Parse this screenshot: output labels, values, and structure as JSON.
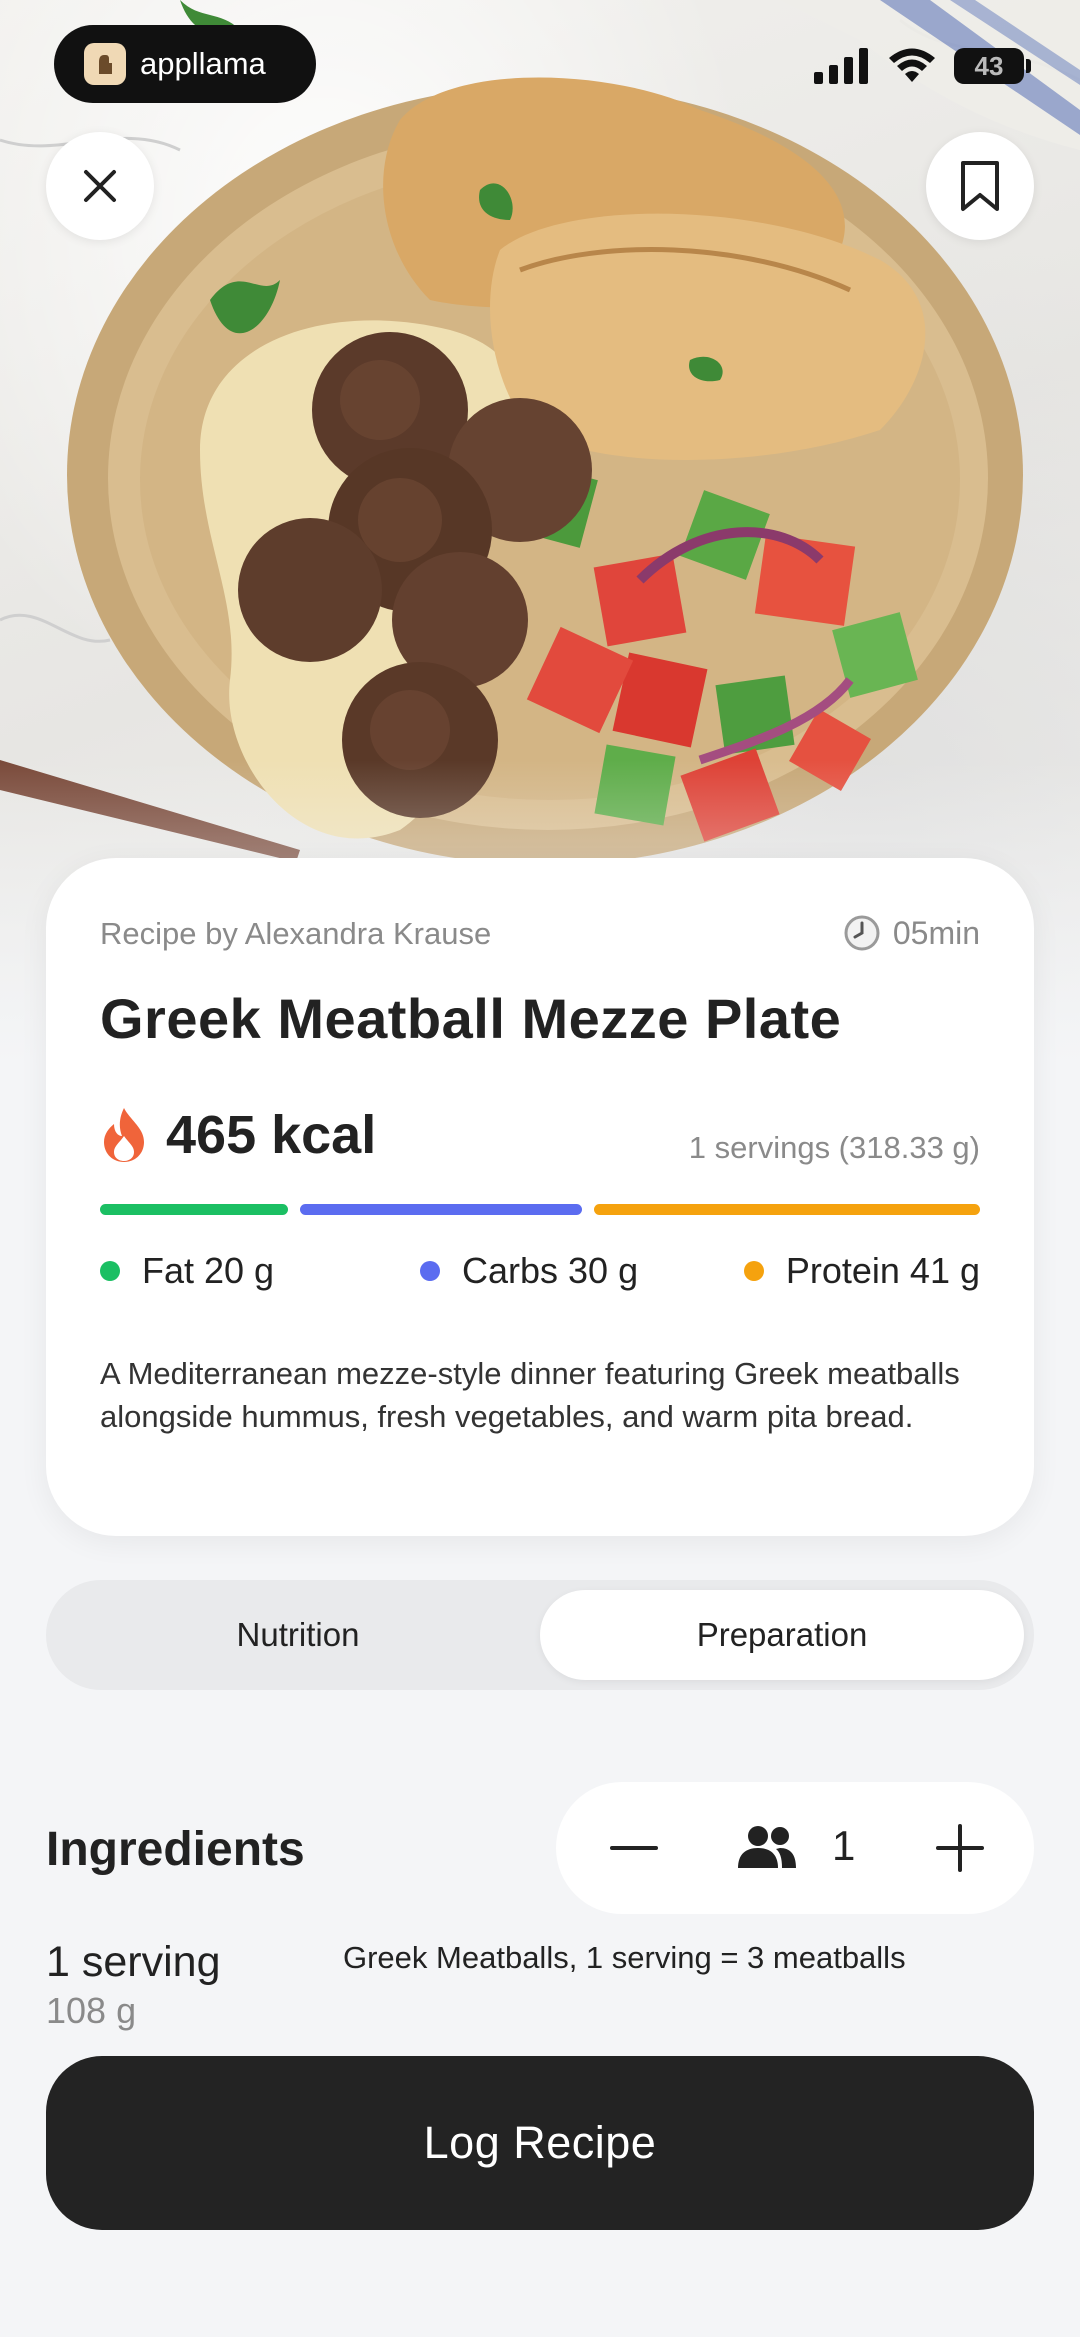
{
  "status_bar": {
    "pill_label": "appllama",
    "battery": "43"
  },
  "recipe": {
    "author": "Recipe by Alexandra Krause",
    "time": "05min",
    "title": "Greek Meatball Mezze Plate",
    "kcal": "465 kcal",
    "servings": "1 servings (318.33 g)",
    "macros": [
      {
        "label": "Fat 20 g",
        "color": "#1bbf63"
      },
      {
        "label": "Carbs 30 g",
        "color": "#5b6cf0"
      },
      {
        "label": "Protein 41 g",
        "color": "#f5a20e"
      }
    ],
    "description": "A Mediterranean mezze-style dinner featuring Greek meatballs alongside hummus, fresh vegetables, and warm pita bread."
  },
  "tabs": {
    "nutrition": "Nutrition",
    "preparation": "Preparation",
    "active": "preparation"
  },
  "ingredients": {
    "title": "Ingredients",
    "serving_count": "1",
    "items": [
      {
        "qty": "1 serving",
        "grams": "108 g",
        "name": "Greek Meatballs, 1 serving = 3 meatballs"
      }
    ]
  },
  "actions": {
    "log_label": "Log Recipe"
  },
  "icons": {
    "close": "close-icon",
    "bookmark": "bookmark-icon",
    "flame": "flame-icon",
    "clock": "clock-icon",
    "people": "people-icon",
    "minus": "minus-icon",
    "plus": "plus-icon"
  }
}
